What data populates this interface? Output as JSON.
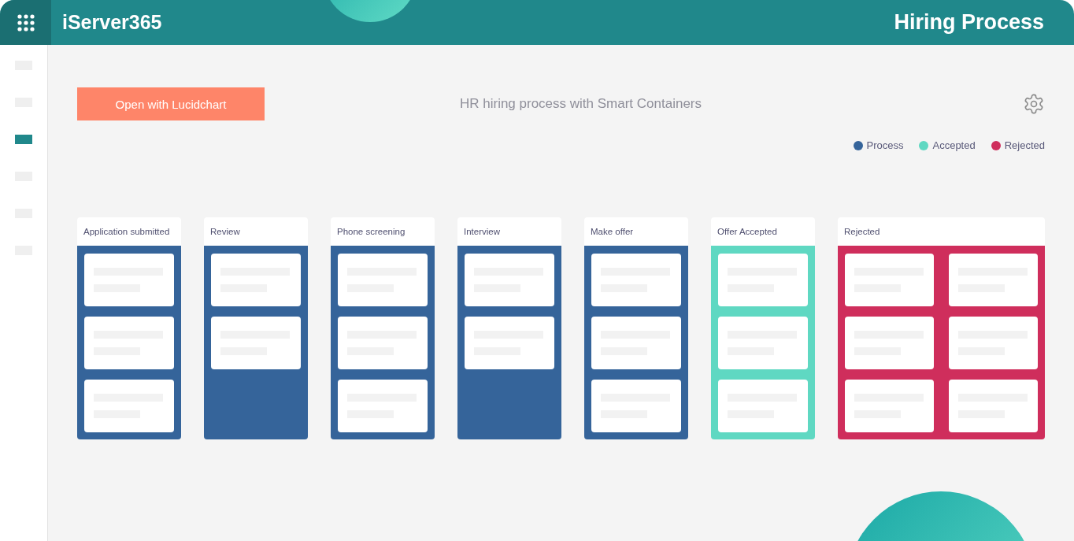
{
  "header": {
    "brand": "iServer365",
    "title": "Hiring Process"
  },
  "sidebar": {
    "items": [
      {
        "selected": false
      },
      {
        "selected": false
      },
      {
        "selected": true
      },
      {
        "selected": false
      },
      {
        "selected": false
      },
      {
        "selected": false
      }
    ]
  },
  "toolbar": {
    "button": "Open with Lucidchart",
    "diagram_title": "HR hiring process with Smart Containers"
  },
  "legend": [
    {
      "label": "Process",
      "color": "#35649a"
    },
    {
      "label": "Accepted",
      "color": "#5fd8c2"
    },
    {
      "label": "Rejected",
      "color": "#cf2e5c"
    }
  ],
  "columns": [
    {
      "title": "Application submitted",
      "color": "#35649a",
      "kind": "single",
      "cards": [
        {
          "kind": "placeholder"
        },
        {
          "kind": "placeholder"
        },
        {
          "kind": "placeholder"
        }
      ]
    },
    {
      "title": "Review",
      "color": "#35649a",
      "kind": "single",
      "cards": [
        {
          "kind": "placeholder"
        },
        {
          "kind": "placeholder"
        }
      ]
    },
    {
      "title": "Phone screening",
      "color": "#35649a",
      "kind": "single",
      "cards": [
        {
          "kind": "placeholder"
        },
        {
          "kind": "placeholder"
        },
        {
          "kind": "placeholder"
        }
      ]
    },
    {
      "title": "Interview",
      "color": "#35649a",
      "kind": "single",
      "cards": [
        {
          "kind": "placeholder"
        },
        {
          "kind": "placeholder"
        }
      ]
    },
    {
      "title": "Make offer",
      "color": "#35649a",
      "kind": "single",
      "cards": [
        {
          "kind": "placeholder"
        },
        {
          "kind": "placeholder"
        },
        {
          "kind": "placeholder"
        }
      ]
    },
    {
      "title": "Offer Accepted",
      "color": "#5fd8c2",
      "kind": "single",
      "cards": [
        {
          "kind": "placeholder"
        },
        {
          "kind": "placeholder"
        },
        {
          "kind": "placeholder"
        }
      ]
    },
    {
      "title": "Rejected",
      "color": "#cf2e5c",
      "kind": "double",
      "cards": [
        {
          "kind": "placeholder"
        },
        {
          "kind": "placeholder"
        },
        {
          "kind": "placeholder"
        },
        {
          "kind": "placeholder"
        },
        {
          "kind": "placeholder"
        },
        {
          "kind": "placeholder"
        }
      ]
    }
  ]
}
